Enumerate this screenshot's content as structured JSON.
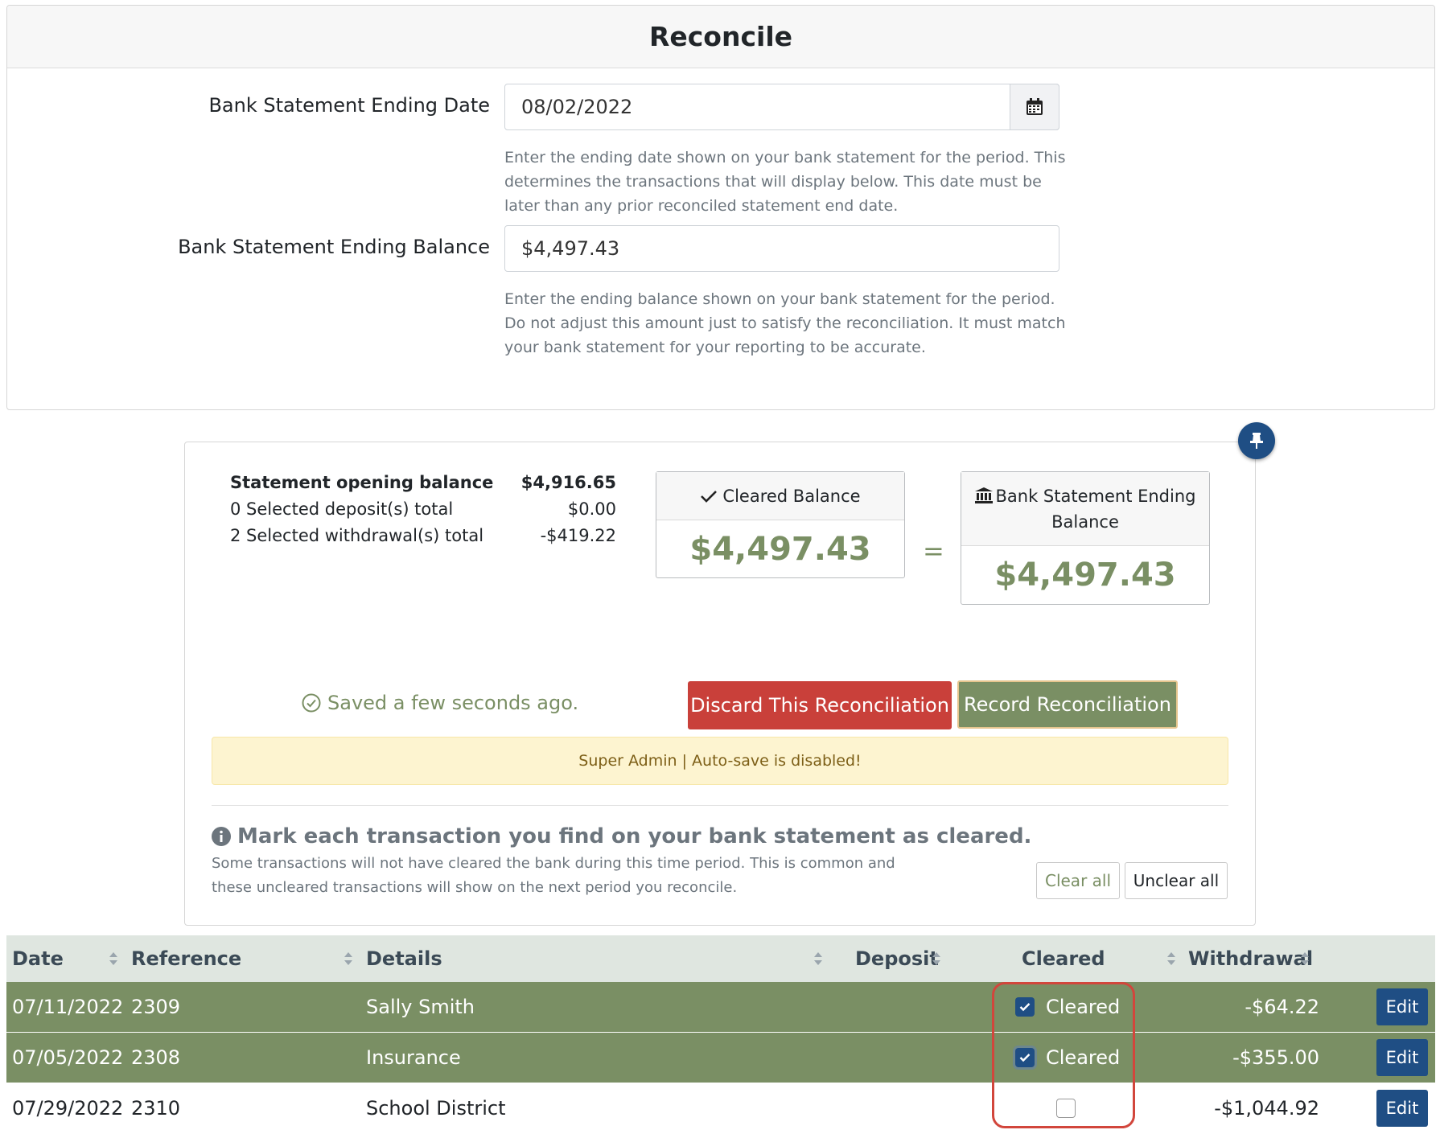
{
  "page": {
    "title": "Reconcile"
  },
  "form": {
    "ending_date": {
      "label": "Bank Statement Ending Date",
      "value": "08/02/2022",
      "help": "Enter the ending date shown on your bank statement for the period. This determines the transactions that will display below. This date must be later than any prior reconciled statement end date."
    },
    "ending_balance": {
      "label": "Bank Statement Ending Balance",
      "value": "$4,497.43",
      "help": "Enter the ending balance shown on your bank statement for the period. Do not adjust this amount just to satisfy the reconciliation. It must match your bank statement for your reporting to be accurate."
    }
  },
  "summary": {
    "opening_label": "Statement opening balance",
    "opening_value": "$4,916.65",
    "deposits_label": "0 Selected deposit(s) total",
    "deposits_value": "$0.00",
    "withdrawals_label": "2 Selected withdrawal(s) total",
    "withdrawals_value": "-$419.22",
    "cleared_title": "Cleared Balance",
    "cleared_value": "$4,497.43",
    "equals": "=",
    "bank_title": "Bank Statement Ending Balance",
    "bank_value": "$4,497.43",
    "saved": "Saved a few seconds ago.",
    "discard_label": "Discard This Reconciliation",
    "record_label": "Record Reconciliation",
    "alert": "Super Admin | Auto-save is disabled!",
    "mark_title": "Mark each transaction you find on your bank statement as cleared.",
    "mark_sub": "Some transactions will not have cleared the bank during this time period. This is common and these uncleared transactions will show on the next period you reconcile.",
    "clear_all": "Clear all",
    "unclear_all": "Unclear all"
  },
  "table": {
    "headers": [
      "Date",
      "Reference",
      "Details",
      "Deposit",
      "Cleared",
      "Withdrawal"
    ],
    "rows": [
      {
        "date": "07/11/2022",
        "reference": "2309",
        "details": "Sally Smith",
        "deposit": "",
        "cleared": true,
        "cleared_label": "Cleared",
        "withdrawal": "-$64.22",
        "edit": "Edit"
      },
      {
        "date": "07/05/2022",
        "reference": "2308",
        "details": "Insurance",
        "deposit": "",
        "cleared": true,
        "cleared_label": "Cleared",
        "withdrawal": "-$355.00",
        "edit": "Edit"
      },
      {
        "date": "07/29/2022",
        "reference": "2310",
        "details": "School District",
        "deposit": "",
        "cleared": false,
        "cleared_label": "",
        "withdrawal": "-$1,044.92",
        "edit": "Edit"
      }
    ]
  },
  "colors": {
    "accent_green": "#7a8f64",
    "primary_blue": "#1f4e84",
    "danger_red": "#c9403a",
    "alert_bg": "#fdf4d0"
  },
  "icons": {
    "calendar": "calendar-icon",
    "pin": "pin-icon",
    "check": "check-icon",
    "bank": "bank-icon",
    "saved": "check-circle-icon",
    "info": "info-icon",
    "sort": "sort-icon"
  }
}
